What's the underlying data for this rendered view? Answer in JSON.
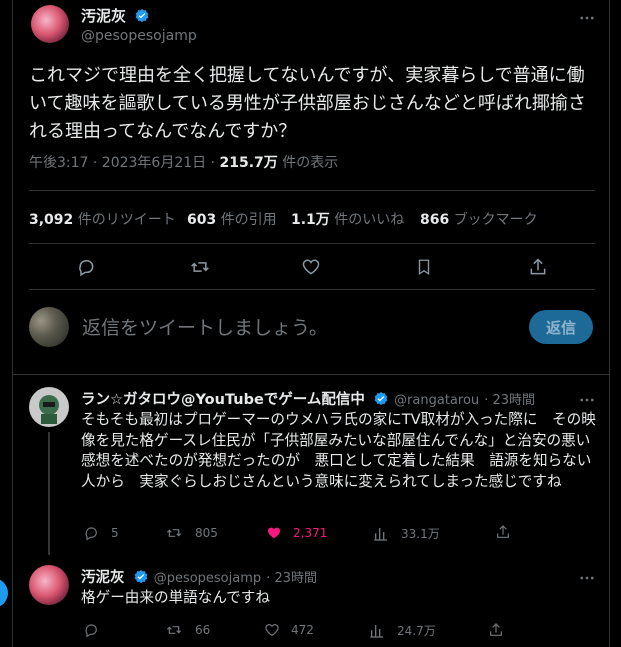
{
  "main_tweet": {
    "author_name": "汚泥灰",
    "author_handle": "@pesopesojamp",
    "text": "これマジで理由を全く把握してないんですが、実家暮らしで普通に働いて趣味を謳歌している男性が子供部屋おじさんなどと呼ばれ揶揄される理由ってなんでなんですか？",
    "timestamp": "午後3:17 · 2023年6月21日",
    "views_count": "215.7万",
    "views_label": "件の表示",
    "more_icon": "more-icon"
  },
  "stats": {
    "retweets": "3,092",
    "retweets_label": "件のリツイート",
    "quotes": "603",
    "quotes_label": "件の引用",
    "likes": "1.1万",
    "likes_label": "件のいいね",
    "bookmarks": "866",
    "bookmarks_label": "ブックマーク"
  },
  "compose": {
    "placeholder": "返信をツイートしましょう。",
    "button_label": "返信"
  },
  "replies": [
    {
      "author_name": "ラン☆ガタロウ@YouTubeでゲーム配信中",
      "author_handle": "@rangatarou",
      "time": "· 23時間",
      "text": "そもそも最初はプロゲーマーのウメハラ氏の家にTV取材が入った際に　その映像を見た格ゲースレ住民が「子供部屋みたいな部屋住んでんな」と治安の悪い感想を述べたのが発想だったのが　悪口として定着した結果　語源を知らない人から　実家ぐらしおじさんという意味に変えられてしまった感じですね",
      "replies_count": "5",
      "retweets_count": "805",
      "likes_count": "2,371",
      "views_count": "33.1万"
    },
    {
      "author_name": "汚泥灰",
      "author_handle": "@pesopesojamp",
      "time": "· 23時間",
      "text": "格ゲー由来の単語なんですね",
      "retweets_count": "66",
      "likes_count": "472",
      "views_count": "24.7万"
    }
  ],
  "colors": {
    "background": "#000000",
    "text": "#e7e9ea",
    "muted": "#71767b",
    "verified": "#1d9bf0",
    "like_active": "#f91880",
    "reply_button": "#1d6a98"
  }
}
